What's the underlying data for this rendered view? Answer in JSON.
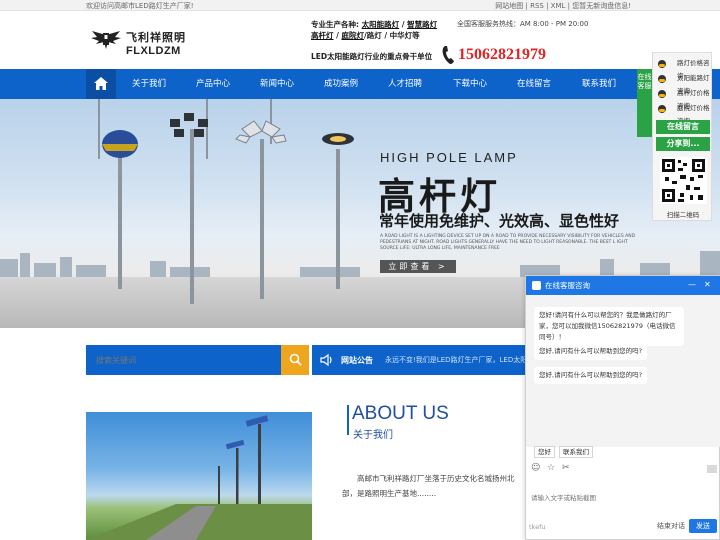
{
  "topbar": {
    "welcome": "欢迎访问高邮市LED路灯生产厂家!",
    "links": "网站地图 | RSS | XML | 您暂无新询盘信息!"
  },
  "header": {
    "logo_cn": "飞利祥照明",
    "logo_en": "FLXLDZM",
    "products_prefix": "专业生产各种:",
    "products": [
      "太阳能路灯",
      "智慧路灯",
      "高杆灯",
      "庭院灯"
    ],
    "products_tail": "/路灯 / 中华灯等",
    "slogan": "LED太阳能路灯行业的重点骨干单位",
    "hotline_label": "全国客服服务热线：AM 8:00 - PM 20:00",
    "phone": "15062821979"
  },
  "nav": {
    "items": [
      "关于我们",
      "产品中心",
      "新闻中心",
      "成功案例",
      "人才招聘",
      "下载中心",
      "在线留言",
      "联系我们"
    ]
  },
  "banner": {
    "title_en": "HIGH POLE LAMP",
    "title_cn": "高杆灯",
    "subtitle": "常年使用免维护、光效高、显色性好",
    "small_text": "A ROAD LIGHT IS A LIGHTING DEVICE SET UP ON A ROAD TO PROVIDE NECESSARY VISIBILITY FOR VEHICLES AND PEDESTRIANS AT NIGHT. ROAD LIGHTS GENERALLY HAVE THE NEED TO LIGHT REASONABLE. THE BEST L IGHT SOURCE LIFE: ULTRA LONG LIFE, MAINTENANCE FREE",
    "button": "立即查看 >"
  },
  "search": {
    "placeholder": "搜索关键词"
  },
  "notice": {
    "title": "网站公告",
    "message": "永远不变!我们是LED路灯生产厂家，LED太阳能路灯"
  },
  "about": {
    "title_en": "ABOUT US",
    "title_cn": "关于我们",
    "text": "高邮市飞利祥路灯厂坐落于历史文化名城扬州北部，是路照明生产基地........"
  },
  "service_panel": {
    "tab": "在线客服",
    "rows": [
      "路灯价格咨询",
      "太阳能路灯咨询",
      "高杆灯价格咨询",
      "庭院灯价格咨询",
      "高杆灯价格咨询"
    ],
    "message_btn": "在线留言",
    "share_btn": "分享到...",
    "scan_label": "扫描二维码"
  },
  "chat": {
    "title": "在线客服咨询",
    "messages": [
      "您好!请问有什么可以帮您的？我是做路灯的厂家，您可以加我微信15062821979（电话微信同号）！",
      "您好,请问有什么可以帮助到您的吗?",
      "您好,请问有什么可以帮助到您的吗?"
    ],
    "quick_replies": [
      "您好",
      "联系我们"
    ],
    "input_placeholder": "请输入文字或粘贴截图",
    "footer_brand": "tkefu",
    "end_label": "结束对话",
    "send_label": "发送"
  },
  "colors": {
    "brand_blue": "#0d63c9",
    "search_button": "#f0a51e",
    "phone_red": "#e02424",
    "service_green": "#2ba245",
    "chat_blue": "#1f77e6"
  }
}
